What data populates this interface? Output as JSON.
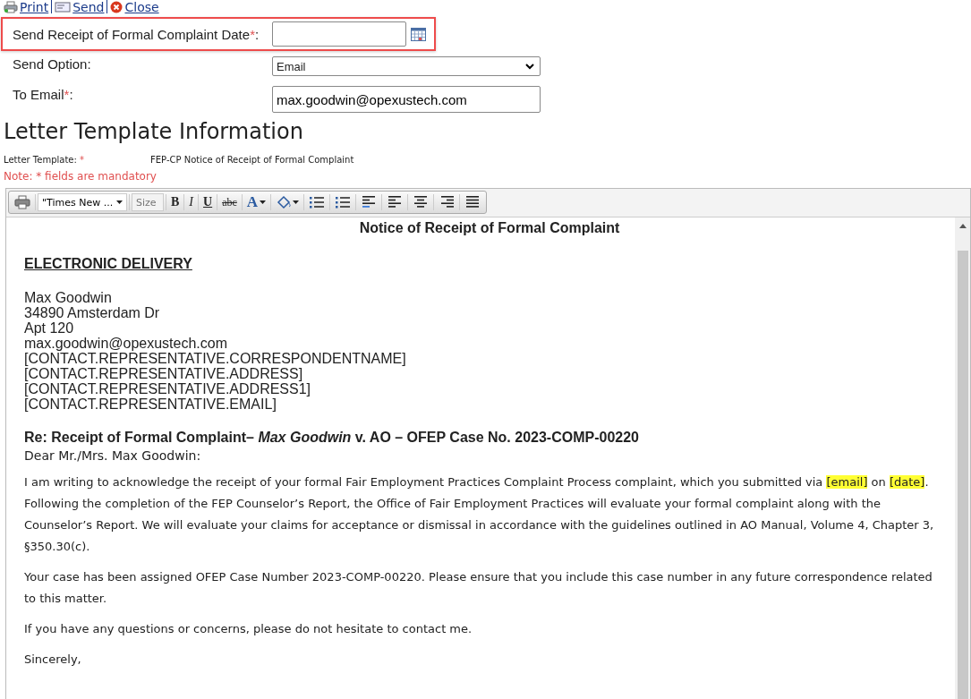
{
  "actions": [
    {
      "kind": "print",
      "label": "Print"
    },
    {
      "kind": "send",
      "label": "Send"
    },
    {
      "kind": "close",
      "label": "Close"
    }
  ],
  "form": [
    {
      "kind": "date",
      "label": "Send Receipt of Formal Complaint Date",
      "required_mark": "*",
      "suffix": ":",
      "highlighted": true
    },
    {
      "kind": "select",
      "label": "Send Option:",
      "highlighted": false,
      "value": "Email"
    },
    {
      "kind": "text",
      "label": "To Email",
      "required_mark": "*",
      "suffix": ":",
      "highlighted": false,
      "value": "max.goodwin@opexustech.com"
    }
  ],
  "section_title": "Letter Template Information",
  "template": {
    "label": "Letter Template:",
    "required_mark": "*",
    "value": "FEP-CP Notice of Receipt of Formal Complaint"
  },
  "note": "Note: * fields are mandatory",
  "toolbar": [
    {
      "kind": "print"
    },
    {
      "kind": "font",
      "value": "\"Times New ..."
    },
    {
      "kind": "size",
      "placeholder": "Size"
    },
    {
      "kind": "bold",
      "label": "B"
    },
    {
      "kind": "italic",
      "label": "I"
    },
    {
      "kind": "underline",
      "label": "U"
    },
    {
      "kind": "strike",
      "label": "abc"
    },
    {
      "kind": "fontcolor",
      "label": "A"
    },
    {
      "kind": "fill"
    },
    {
      "kind": "bullets"
    },
    {
      "kind": "numbers"
    },
    {
      "kind": "align-left"
    },
    {
      "kind": "align-left-plain"
    },
    {
      "kind": "align-center"
    },
    {
      "kind": "align-right"
    },
    {
      "kind": "justify"
    }
  ],
  "letter": {
    "title": "Notice of Receipt of Formal Complaint",
    "delivery": "ELECTRONIC DELIVERY",
    "address": [
      "Max Goodwin",
      "34890 Amsterdam Dr",
      "Apt 120",
      "max.goodwin@opexustech.com",
      "[CONTACT.REPRESENTATIVE.CORRESPONDENTNAME]",
      "[CONTACT.REPRESENTATIVE.ADDRESS]",
      "[CONTACT.REPRESENTATIVE.ADDRESS1]",
      "[CONTACT.REPRESENTATIVE.EMAIL]"
    ],
    "subject": "Re: Receipt of Formal Complaint– *Max Goodwin* v. AO – OFEP Case No. 2023-COMP-00220",
    "greeting": "Dear Mr./Mrs. Max Goodwin:",
    "paragraphs": [
      [
        {
          "text": "I am writing to acknowledge the receipt of your formal Fair Employment Practices Complaint Process complaint, which you submitted via ",
          "highlight": false
        },
        {
          "text": "[email]",
          "highlight": true
        },
        {
          "text": " on ",
          "highlight": false
        },
        {
          "text": "[date]",
          "highlight": true
        },
        {
          "text": ". Following the completion of the FEP Counselor’s Report, the Office of Fair Employment Practices will evaluate your formal complaint along with the Counselor’s Report. We will evaluate your claims for acceptance or dismissal in accordance with the guidelines outlined in AO Manual, Volume 4, Chapter 3, §350.30(c).",
          "highlight": false
        }
      ],
      [
        {
          "text": "Your case has been assigned OFEP Case Number 2023-COMP-00220. Please ensure that you include this case number in any future correspondence related to this matter.",
          "highlight": false
        }
      ],
      [
        {
          "text": "If you have any questions or concerns, please do not hesitate to contact me.",
          "highlight": false
        }
      ],
      [
        {
          "text": "Sincerely,",
          "highlight": false
        }
      ]
    ]
  }
}
